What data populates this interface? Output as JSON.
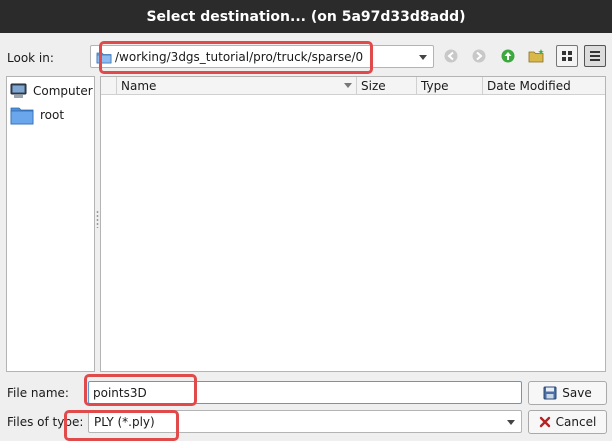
{
  "window": {
    "title": "Select destination... (on 5a97d33d8add)"
  },
  "look_in": {
    "label": "Look in:",
    "path": "/working/3dgs_tutorial/pro/truck/sparse/0"
  },
  "toolbar": {
    "icons": [
      "back-icon",
      "forward-icon",
      "parent-directory-icon",
      "new-folder-icon",
      "list-view-icon",
      "detail-view-icon"
    ]
  },
  "sidebar": {
    "items": [
      {
        "label": "Computer",
        "icon": "computer-icon"
      },
      {
        "label": "root",
        "icon": "folder-icon"
      }
    ]
  },
  "file_list": {
    "columns": [
      "Name",
      "Size",
      "Type",
      "Date Modified"
    ],
    "rows": []
  },
  "file_name": {
    "label": "File name:",
    "value": "points3D"
  },
  "file_type": {
    "label": "Files of type:",
    "value": "PLY (*.ply)"
  },
  "buttons": {
    "save": "Save",
    "cancel": "Cancel"
  },
  "colors": {
    "titlebar": "#2b2b2b",
    "highlight": "#e04a4a",
    "focus_border": "#5b9bd5"
  }
}
